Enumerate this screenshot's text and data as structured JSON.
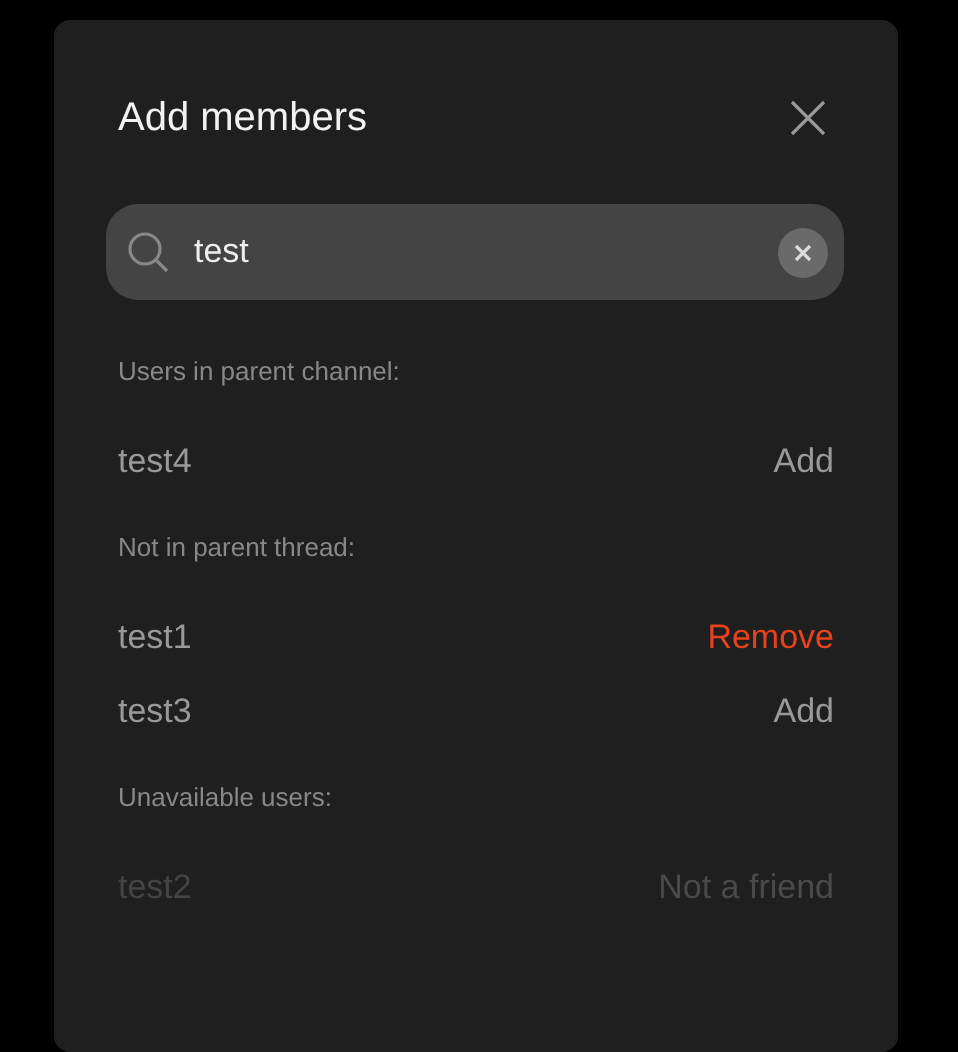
{
  "dialog": {
    "title": "Add members"
  },
  "search": {
    "value": "test"
  },
  "sections": [
    {
      "label": "Users in parent channel:",
      "users": [
        {
          "name": "test4",
          "action": "Add",
          "kind": "add"
        }
      ]
    },
    {
      "label": "Not in parent thread:",
      "users": [
        {
          "name": "test1",
          "action": "Remove",
          "kind": "remove"
        },
        {
          "name": "test3",
          "action": "Add",
          "kind": "add"
        }
      ]
    },
    {
      "label": "Unavailable users:",
      "users": [
        {
          "name": "test2",
          "action": "Not a friend",
          "kind": "unavailable"
        }
      ]
    }
  ]
}
